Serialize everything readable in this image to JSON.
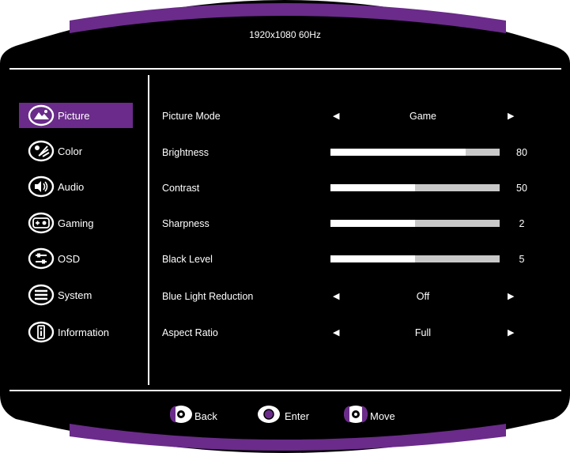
{
  "status": {
    "resolution": "1920x1080 60Hz"
  },
  "sidebar": {
    "items": [
      {
        "label": "Picture",
        "icon": "picture-icon",
        "active": true
      },
      {
        "label": "Color",
        "icon": "color-icon",
        "active": false
      },
      {
        "label": "Audio",
        "icon": "audio-icon",
        "active": false
      },
      {
        "label": "Gaming",
        "icon": "gaming-icon",
        "active": false
      },
      {
        "label": "OSD",
        "icon": "osd-icon",
        "active": false
      },
      {
        "label": "System",
        "icon": "system-icon",
        "active": false
      },
      {
        "label": "Information",
        "icon": "information-icon",
        "active": false
      }
    ]
  },
  "settings": {
    "picture_mode": {
      "label": "Picture Mode",
      "value": "Game"
    },
    "brightness": {
      "label": "Brightness",
      "value": "80",
      "level": 0.8
    },
    "contrast": {
      "label": "Contrast",
      "value": "50",
      "level": 0.5
    },
    "sharpness": {
      "label": "Sharpness",
      "value": "2",
      "level": 0.5
    },
    "black_level": {
      "label": "Black Level",
      "value": "5",
      "level": 0.5
    },
    "blue_light": {
      "label": "Blue Light Reduction",
      "value": "Off"
    },
    "aspect_ratio": {
      "label": "Aspect Ratio",
      "value": "Full"
    }
  },
  "footer": {
    "back_label": "Back",
    "enter_label": "Enter",
    "move_label": "Move"
  },
  "colors": {
    "frame": "#000000",
    "accent": "#6a2b8a",
    "slider_fill": "#ffffff",
    "slider_track": "#c8c8c8"
  }
}
